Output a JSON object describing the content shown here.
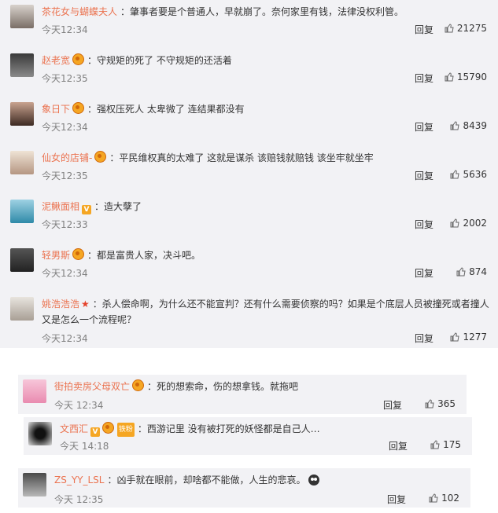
{
  "comments": [
    {
      "user": "茶花女与蝴蝶夫人",
      "text": "：肇事者要是个普通人，早就崩了。奈何家里有钱，法律没权利管。",
      "time": "今天12:34",
      "reply": "回复",
      "likes": "21275"
    },
    {
      "user": "赵老宽",
      "text": "：守规矩的死了 不守规矩的还活着",
      "time": "今天12:35",
      "reply": "回复",
      "likes": "15790"
    },
    {
      "user": "象日下",
      "text": "：强权压死人 太卑微了 连结果都没有",
      "time": "今天12:34",
      "reply": "回复",
      "likes": "8439"
    },
    {
      "user": "仙女的店铺-",
      "text": "：平民维权真的太难了 这就是谋杀 该赔钱就赔钱 该坐牢就坐牢",
      "time": "今天12:35",
      "reply": "回复",
      "likes": "5636"
    },
    {
      "user": "泥鳅面相",
      "text": "：造大孽了",
      "time": "今天12:33",
      "reply": "回复",
      "likes": "2002"
    },
    {
      "user": "轻男斯",
      "text": "：都是富贵人家，决斗吧。",
      "time": "今天12:34",
      "reply": "回复",
      "likes": "874"
    },
    {
      "user": "姚浩浩浩",
      "text": "：杀人偿命啊，为什么还不能宣判？还有什么需要侦察的吗？如果是个底层人员被撞死或者撞人",
      "text2": "又是怎么一个流程呢？",
      "time": "今天12:34",
      "reply": "回复",
      "likes": "1277"
    }
  ],
  "sub_comments": [
    {
      "user": "街拍卖房父母双亡",
      "text": "：死的想索命，伤的想拿钱。就拖吧",
      "time": "今天 12:34",
      "reply": "回复",
      "likes": "365"
    },
    {
      "user": "文西汇",
      "tag": "铁粉",
      "text": "：西游记里 没有被打死的妖怪都是自己人…",
      "time": "今天 14:18",
      "reply": "回复",
      "likes": "175"
    },
    {
      "user": "ZS_YY_LSL",
      "text": "：凶手就在眼前，却啥都不能做，人生的悲哀。",
      "time": "今天 12:35",
      "reply": "回复",
      "likes": "102"
    }
  ]
}
